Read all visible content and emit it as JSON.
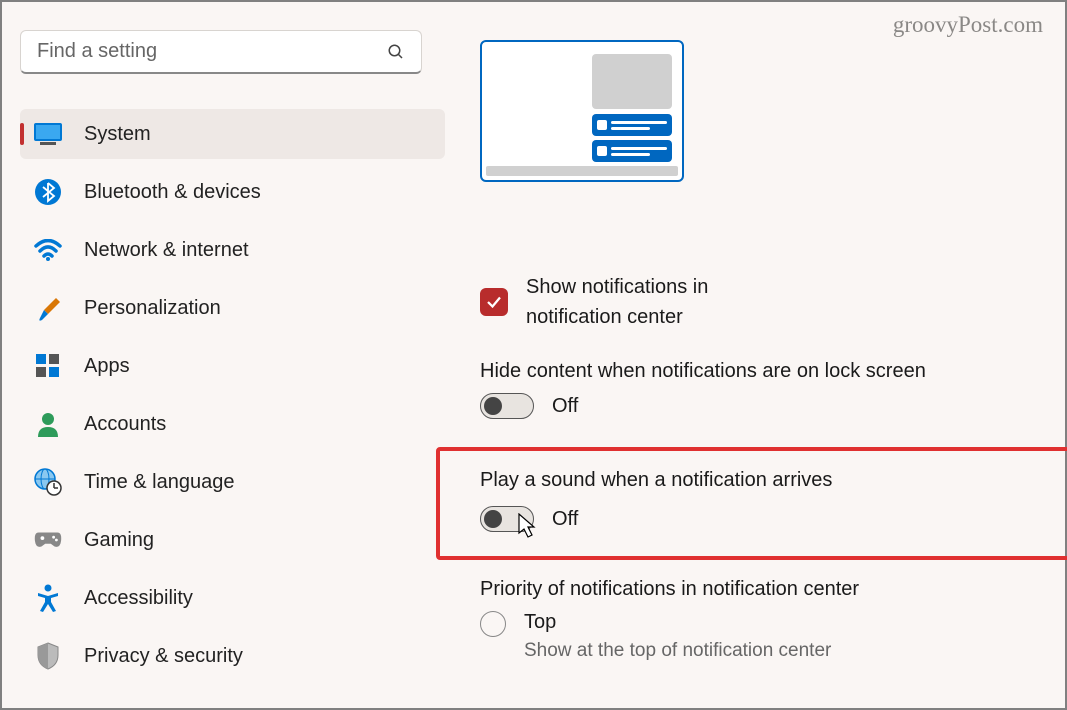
{
  "watermark": "groovyPost.com",
  "search": {
    "placeholder": "Find a setting"
  },
  "sidebar": {
    "items": [
      {
        "label": "System"
      },
      {
        "label": "Bluetooth & devices"
      },
      {
        "label": "Network & internet"
      },
      {
        "label": "Personalization"
      },
      {
        "label": "Apps"
      },
      {
        "label": "Accounts"
      },
      {
        "label": "Time & language"
      },
      {
        "label": "Gaming"
      },
      {
        "label": "Accessibility"
      },
      {
        "label": "Privacy & security"
      }
    ]
  },
  "main": {
    "show_in_center": {
      "label": "Show notifications in notification center"
    },
    "hide_content": {
      "label": "Hide content when notifications are on lock screen",
      "state": "Off"
    },
    "play_sound": {
      "label": "Play a sound when a notification arrives",
      "state": "Off"
    },
    "priority": {
      "label": "Priority of notifications in notification center",
      "top": {
        "label": "Top",
        "sub": "Show at the top of notification center"
      }
    }
  }
}
